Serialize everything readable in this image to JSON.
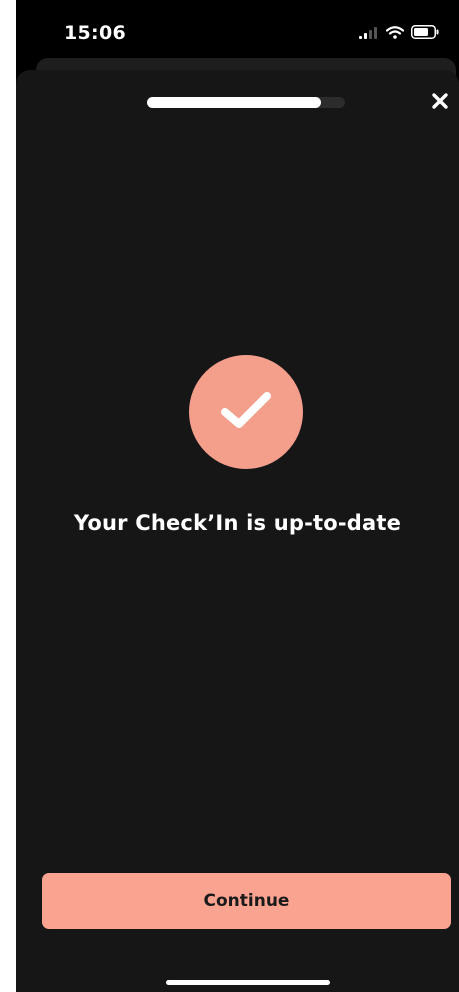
{
  "status_bar": {
    "time": "15:06",
    "icons": [
      "cellular-signal-icon",
      "wifi-icon",
      "battery-icon"
    ]
  },
  "progress": {
    "value": 0.88
  },
  "close": {
    "icon": "close-icon"
  },
  "success": {
    "icon": "checkmark-icon",
    "message": "Your Check’In is up-to-date"
  },
  "actions": {
    "continue_label": "Continue"
  },
  "colors": {
    "accent": "#fba391",
    "sheet_background": "#161616",
    "text_primary": "#ffffff"
  }
}
